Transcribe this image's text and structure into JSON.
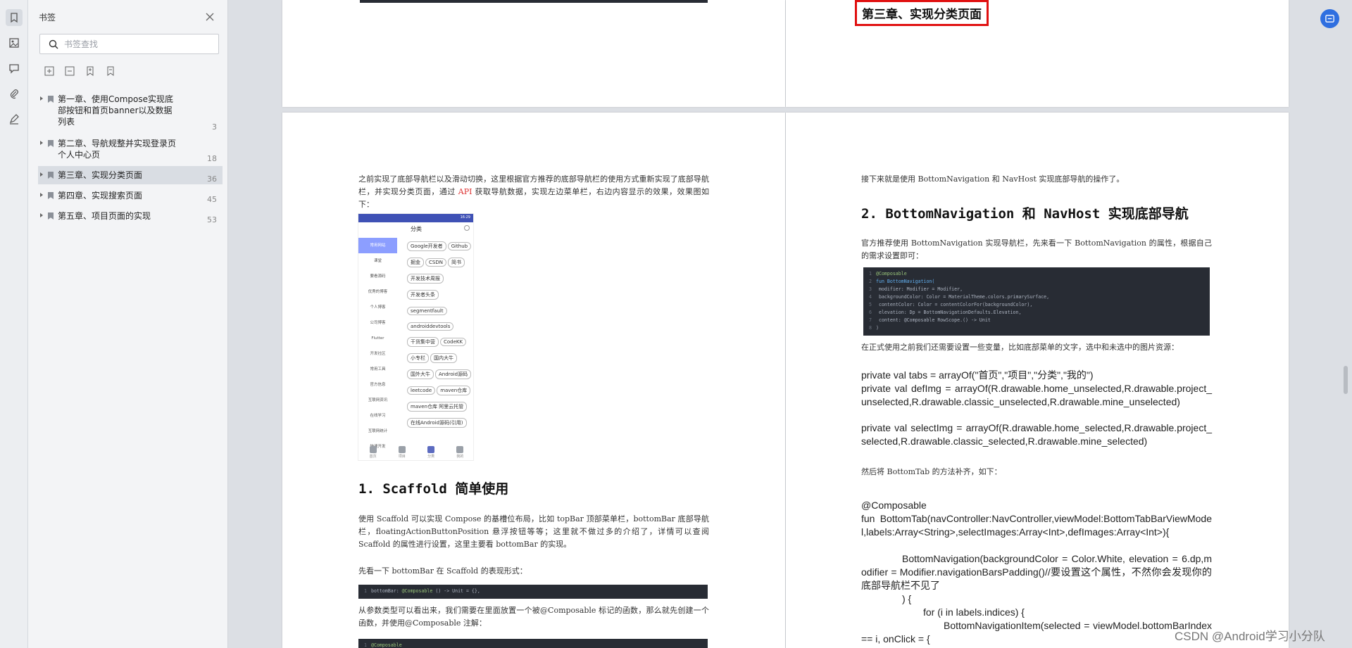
{
  "panel": {
    "title": "书签",
    "search_placeholder": "书签查找"
  },
  "bookmarks": [
    {
      "label": "第一章、使用Compose实现底部按钮和首页banner以及数据列表",
      "page": "3"
    },
    {
      "label": "第二章、导航规整并实现登录页个人中心页",
      "page": "18"
    },
    {
      "label": "第三章、实现分类页面",
      "page": "36"
    },
    {
      "label": "第四章、实现搜索页面",
      "page": "45"
    },
    {
      "label": "第五章、项目页面的实现",
      "page": "53"
    }
  ],
  "doc": {
    "chapter_title": "第三章、实现分类页面",
    "intro_a": "之前实现了底部导航栏以及滑动切换，这里根据官方推荐的底部导航栏的使用方式重新实现了底部导航栏，并实现分类页面，通过 ",
    "intro_api": "API",
    "intro_b": " 获取导航数据，实现左边菜单栏，右边内容显示的效果，效果图如下：",
    "phone_title": "分类",
    "phone_status": "16:29",
    "phone_menu": [
      "常用网站",
      "课堂",
      "要看源码",
      "优秀的博客",
      "个人博客",
      "公司博客",
      "Flutter",
      "开发社区",
      "常用工具",
      "官方信息",
      "互联网资讯",
      "在线学习",
      "互联网统计",
      "快速开发"
    ],
    "phone_chips": [
      "Google开发者",
      "Github",
      "掘金",
      "CSDN",
      "简书",
      "开发技术周报",
      "开发者头条",
      "segmentfault",
      "androiddevtools",
      "干货集中营",
      "CodeKK",
      "小专栏",
      "国内大牛",
      "国外大牛",
      "Android源码",
      "leetcode",
      "maven仓库",
      "maven仓库 阿里云托管",
      "在线Android源码(引用)"
    ],
    "phone_tabs": [
      "首页",
      "项目",
      "分类",
      "我的"
    ],
    "h_scaffold": "1. Scaffold 简单使用",
    "p_scaffold": "使用 Scaffold 可以实现 Compose 的基槽位布局，比如 topBar 顶部菜单栏，bottomBar 底部导航栏，floatingActionButtonPosition 悬浮按钮等等；这里就不做过多的介绍了，详情可以查阅 Scaffold 的属性进行设置，这里主要看 bottomBar 的实现。",
    "p_bottombar": "先看一下 bottomBar 在 Scaffold 的表现形式：",
    "code1_prefix": "bottomBar: ",
    "code1_anno": "@Composable",
    "code1_suffix": " () -> Unit = {},",
    "p_param": "从参数类型可以看出来，我们需要在里面放置一个被@Composable 标记的函数，那么就先创建一个函数，并使用@Composable 注解：",
    "code2_anno": "@Composable",
    "right_intro": "接下来就是使用 BottomNavigation 和 NavHost 实现底部导航的操作了。",
    "h_nav": "2. BottomNavigation 和 NavHost 实现底部导航",
    "p_official": "官方推荐使用 BottomNavigation 实现导航栏，先来看一下 BottomNavigation 的属性，根据自己的需求设置即可：",
    "code3": [
      {
        "n": "1",
        "t": "@Composable"
      },
      {
        "n": "2",
        "t": "fun BottomNavigation("
      },
      {
        "n": "3",
        "t": "    modifier: Modifier = Modifier,"
      },
      {
        "n": "4",
        "t": "    backgroundColor: Color = MaterialTheme.colors.primarySurface,"
      },
      {
        "n": "5",
        "t": "    contentColor: Color = contentColorFor(backgroundColor),"
      },
      {
        "n": "6",
        "t": "    elevation: Dp = BottomNavigationDefaults.Elevation,"
      },
      {
        "n": "7",
        "t": "    content: @Composable RowScope.() -> Unit"
      },
      {
        "n": "8",
        "t": ")"
      }
    ],
    "p_vars": "在正式使用之前我们还需要设置一些变量，比如底部菜单的文字，选中和未选中的图片资源：",
    "code_tabs": "private val tabs = arrayOf(\"首页\",\"项目\",\"分类\",\"我的\")",
    "code_def": "private val defImg = arrayOf(R.drawable.home_unselected,R.drawable.project_unselected,R.drawable.classic_unselected,R.drawable.mine_unselected)",
    "code_sel": "private val selectImg = arrayOf(R.drawable.home_selected,R.drawable.project_selected,R.drawable.classic_selected,R.drawable.mine_selected)",
    "p_then": "然后将 BottomTab 的方法补齐，如下：",
    "code_anno": "@Composable",
    "code_fun": "fun BottomTab(navController:NavController,viewModel:BottomTabBarViewModel,labels:Array<String>,selectImages:Array<Int>,defImages:Array<Int>){",
    "code_bn": "BottomNavigation(backgroundColor = Color.White, elevation = 6.dp,modifier = Modifier.navigationBarsPadding()//要设置这个属性，不然你会发现你的底部导航栏不见了",
    "code_brace": ") {",
    "code_for": "for (i in labels.indices) {",
    "code_item": "BottomNavigationItem(selected = viewModel.bottomBarIndex == i, onClick = {"
  },
  "watermark": "CSDN @Android学习小分队",
  "colors": {
    "accent": "#2f6fe0",
    "highlight": "#e01010",
    "code_bg": "#282c34"
  }
}
